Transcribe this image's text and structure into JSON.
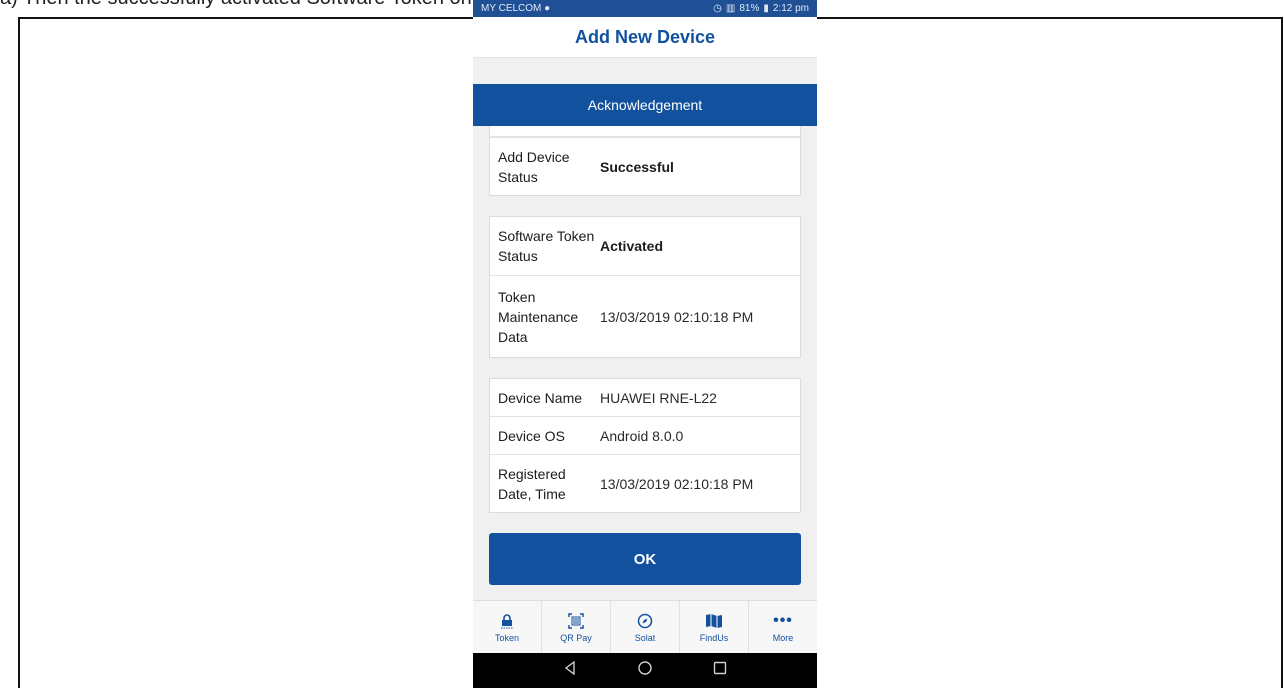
{
  "document": {
    "cut_text": "a) Then the successfully activated Software Token on your mobile device"
  },
  "statusbar": {
    "carrier": "MY CELCOM",
    "right": "81%",
    "time": "2:12 pm"
  },
  "appbar": {
    "title": "Add New Device"
  },
  "section": {
    "title": "Acknowledgement"
  },
  "cards": {
    "status": [
      {
        "label": "Add Device Status",
        "value": "Successful"
      }
    ],
    "token": [
      {
        "label": "Software Token Status",
        "value": "Activated"
      },
      {
        "label": "Token Maintenance Data",
        "value": "13/03/2019 02:10:18 PM"
      }
    ],
    "device": [
      {
        "label": "Device Name",
        "value": "HUAWEI RNE-L22"
      },
      {
        "label": "Device OS",
        "value": "Android 8.0.0"
      },
      {
        "label": "Registered Date, Time",
        "value": "13/03/2019 02:10:18 PM"
      }
    ]
  },
  "ok_button": {
    "label": "OK"
  },
  "tabbar": {
    "items": [
      {
        "label": "Token",
        "icon": "lock-icon"
      },
      {
        "label": "QR Pay",
        "icon": "qr-icon"
      },
      {
        "label": "Solat",
        "icon": "compass-icon"
      },
      {
        "label": "FindUs",
        "icon": "map-icon"
      },
      {
        "label": "More",
        "icon": "more-icon"
      }
    ]
  },
  "colors": {
    "brand": "#12519e",
    "statusbar": "#1f4f95"
  }
}
